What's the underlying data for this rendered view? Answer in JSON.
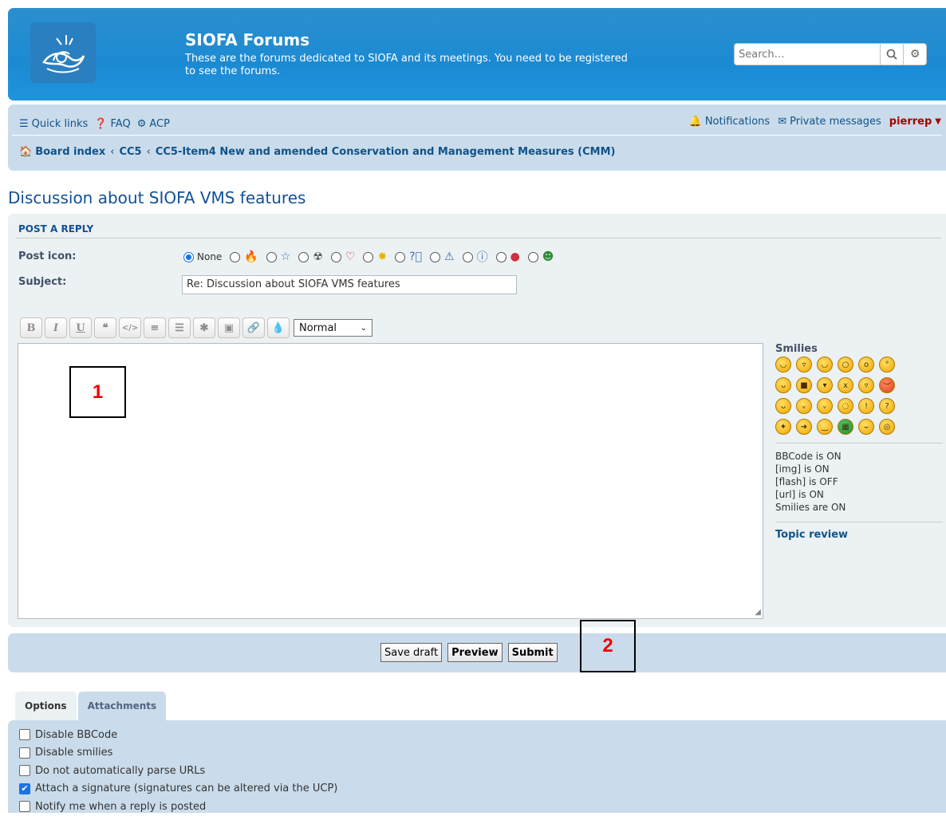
{
  "header": {
    "title": "SIOFA Forums",
    "description": "These are the forums dedicated to SIOFA and its meetings. You need to be registered to see the forums.",
    "search_placeholder": "Search…"
  },
  "nav": {
    "quick_links": "Quick links",
    "faq": "FAQ",
    "acp": "ACP",
    "notifications": "Notifications",
    "private_messages": "Private messages",
    "username": "pierrep"
  },
  "breadcrumbs": [
    "Board index",
    "CC5",
    "CC5-Item4 New and amended Conservation and Management Measures (CMM)"
  ],
  "page_title": "Discussion about SIOFA VMS features",
  "post": {
    "heading": "POST A REPLY",
    "post_icon_label": "Post icon:",
    "none_label": "None",
    "subject_label": "Subject:",
    "subject_value": "Re: Discussion about SIOFA VMS features",
    "font_size": "Normal"
  },
  "sidebar": {
    "smilies_title": "Smilies",
    "bbcode": "BBCode is ON",
    "img": "[img] is ON",
    "flash": "[flash] is OFF",
    "url": "[url] is ON",
    "smilies_status": "Smilies are ON",
    "topic_review": "Topic review"
  },
  "buttons": {
    "save_draft": "Save draft",
    "preview": "Preview",
    "submit": "Submit"
  },
  "annotations": [
    "1",
    "2"
  ],
  "tabs": [
    "Options",
    "Attachments"
  ],
  "options": [
    {
      "label": "Disable BBCode",
      "checked": false
    },
    {
      "label": "Disable smilies",
      "checked": false
    },
    {
      "label": "Do not automatically parse URLs",
      "checked": false
    },
    {
      "label": "Attach a signature (signatures can be altered via the UCP)",
      "checked": true
    },
    {
      "label": "Notify me when a reply is posted",
      "checked": false
    }
  ]
}
